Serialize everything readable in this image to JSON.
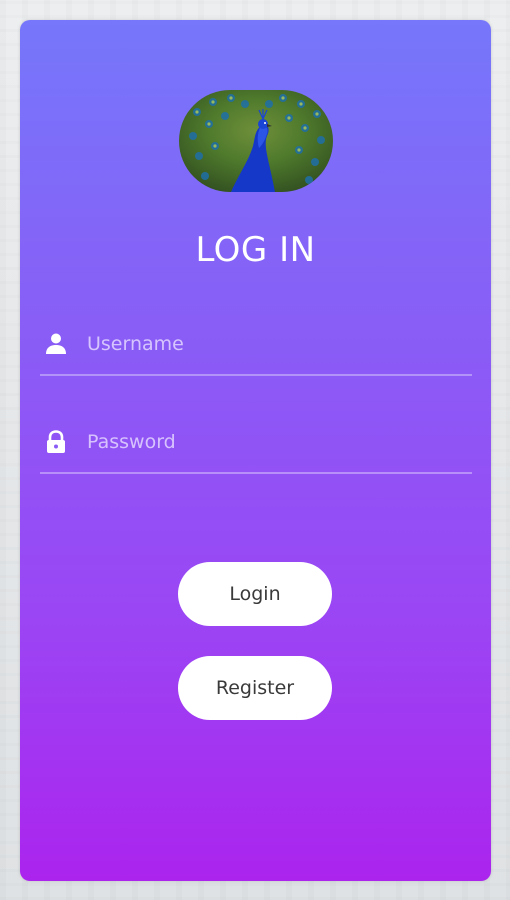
{
  "login_card": {
    "title": "LOG IN",
    "avatar_icon": "peacock-image",
    "username": {
      "icon": "user-icon",
      "placeholder": "Username",
      "value": ""
    },
    "password": {
      "icon": "lock-icon",
      "placeholder": "Password",
      "value": ""
    },
    "buttons": {
      "login_label": "Login",
      "register_label": "Register"
    }
  },
  "colors": {
    "card_gradient_top": "#7677fb",
    "card_gradient_bottom": "#ab24ee",
    "button_bg": "#ffffff",
    "button_text": "#3a3a3a",
    "title_text": "#ffffff"
  }
}
